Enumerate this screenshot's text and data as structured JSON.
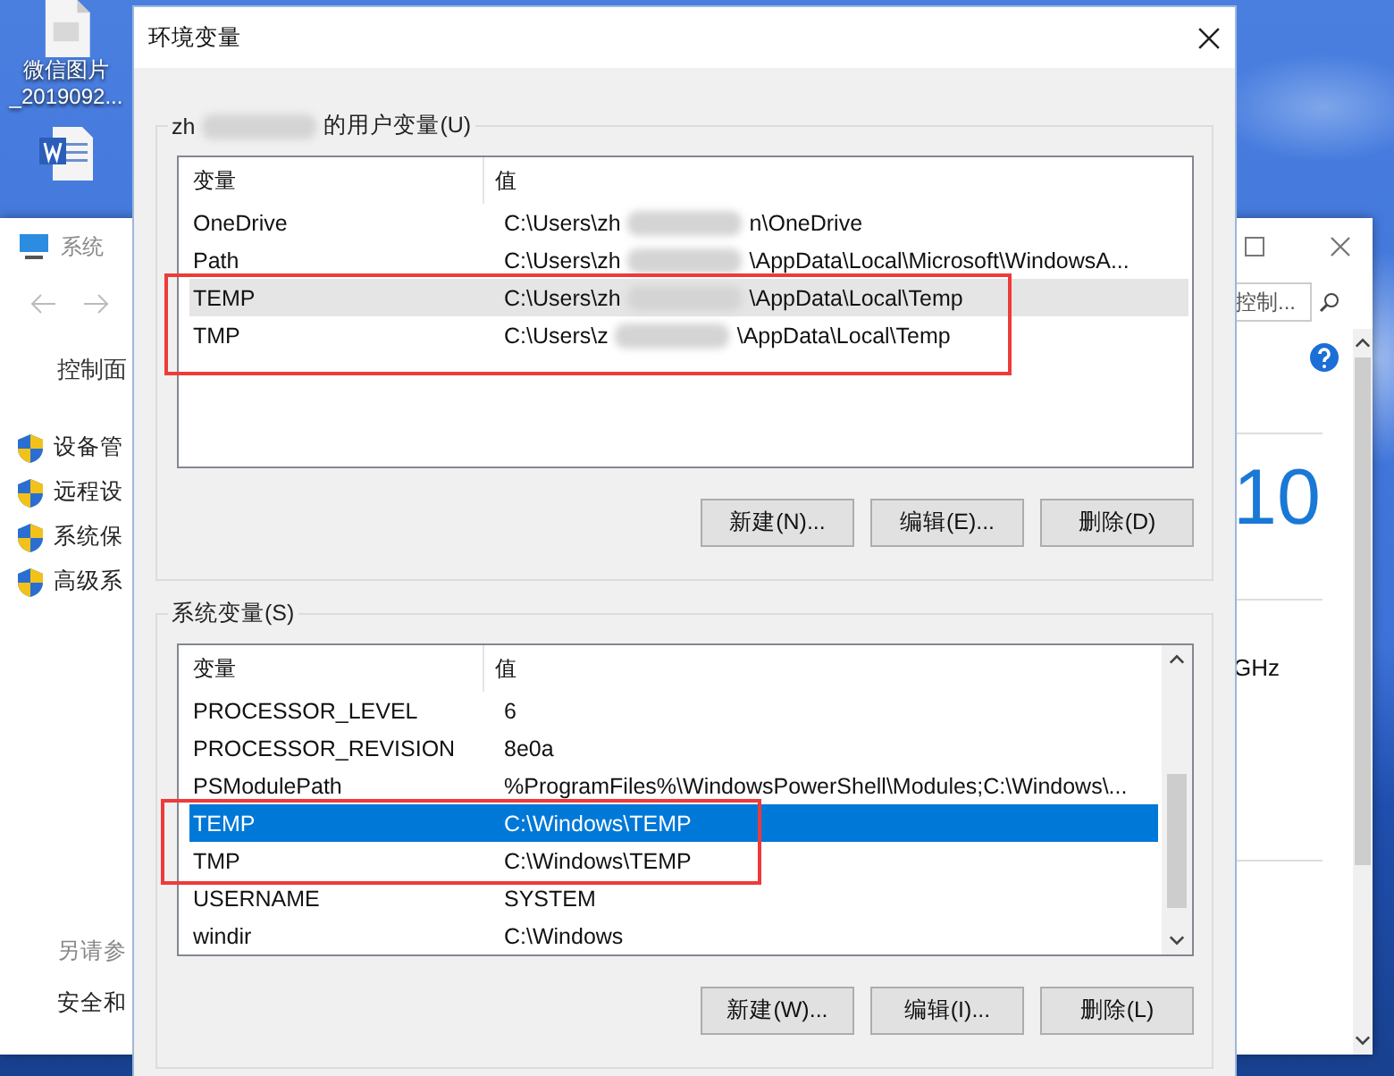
{
  "desktop_icons": [
    {
      "kind": "image",
      "lines": [
        "微信图片",
        "_2019092..."
      ]
    },
    {
      "kind": "word"
    }
  ],
  "system_window": {
    "title": "系统",
    "sidebar_heading": "控制面",
    "tasks": [
      "设备管",
      "远程设",
      "系统保",
      "高级系"
    ],
    "see_also_heading": "另请参",
    "see_also_items": [
      "安全和"
    ],
    "search": {
      "placeholder": "控制..."
    },
    "edition_fragment": "10",
    "cpu_fragment": "GHz"
  },
  "dialog": {
    "title": "环境变量",
    "groups": [
      {
        "kind": "user",
        "label_parts": [
          "zh",
          "的用户变量(U)"
        ],
        "columns": [
          "变量",
          "值"
        ],
        "scrollable": false,
        "rows": [
          {
            "name": "OneDrive",
            "value_parts": [
              "C:\\Users\\zh",
              "n\\OneDrive"
            ],
            "selected": false,
            "hovered": false,
            "marked": false
          },
          {
            "name": "Path",
            "value_parts": [
              "C:\\Users\\zh",
              "\\AppData\\Local\\Microsoft\\WindowsA..."
            ],
            "selected": false,
            "hovered": false,
            "marked": false
          },
          {
            "name": "TEMP",
            "value_parts": [
              "C:\\Users\\zh",
              "\\AppData\\Local\\Temp"
            ],
            "selected": false,
            "hovered": true,
            "marked": true
          },
          {
            "name": "TMP",
            "value_parts": [
              "C:\\Users\\z",
              "\\AppData\\Local\\Temp"
            ],
            "selected": false,
            "hovered": false,
            "marked": true
          }
        ],
        "buttons": [
          "新建(N)...",
          "编辑(E)...",
          "删除(D)"
        ]
      },
      {
        "kind": "system",
        "label_parts": [
          "系统变量(S)"
        ],
        "columns": [
          "变量",
          "值"
        ],
        "scrollable": true,
        "rows": [
          {
            "name": "PROCESSOR_LEVEL",
            "value_parts": [
              "6"
            ],
            "selected": false,
            "hovered": false,
            "marked": false
          },
          {
            "name": "PROCESSOR_REVISION",
            "value_parts": [
              "8e0a"
            ],
            "selected": false,
            "hovered": false,
            "marked": false
          },
          {
            "name": "PSModulePath",
            "value_parts": [
              "%ProgramFiles%\\WindowsPowerShell\\Modules;C:\\Windows\\..."
            ],
            "selected": false,
            "hovered": false,
            "marked": false
          },
          {
            "name": "TEMP",
            "value_parts": [
              "C:\\Windows\\TEMP"
            ],
            "selected": true,
            "hovered": false,
            "marked": true
          },
          {
            "name": "TMP",
            "value_parts": [
              "C:\\Windows\\TEMP"
            ],
            "selected": false,
            "hovered": false,
            "marked": true
          },
          {
            "name": "USERNAME",
            "value_parts": [
              "SYSTEM"
            ],
            "selected": false,
            "hovered": false,
            "marked": false
          },
          {
            "name": "windir",
            "value_parts": [
              "C:\\Windows"
            ],
            "selected": false,
            "hovered": false,
            "marked": false
          }
        ],
        "buttons": [
          "新建(W)...",
          "编辑(I)...",
          "删除(L)"
        ]
      }
    ]
  }
}
